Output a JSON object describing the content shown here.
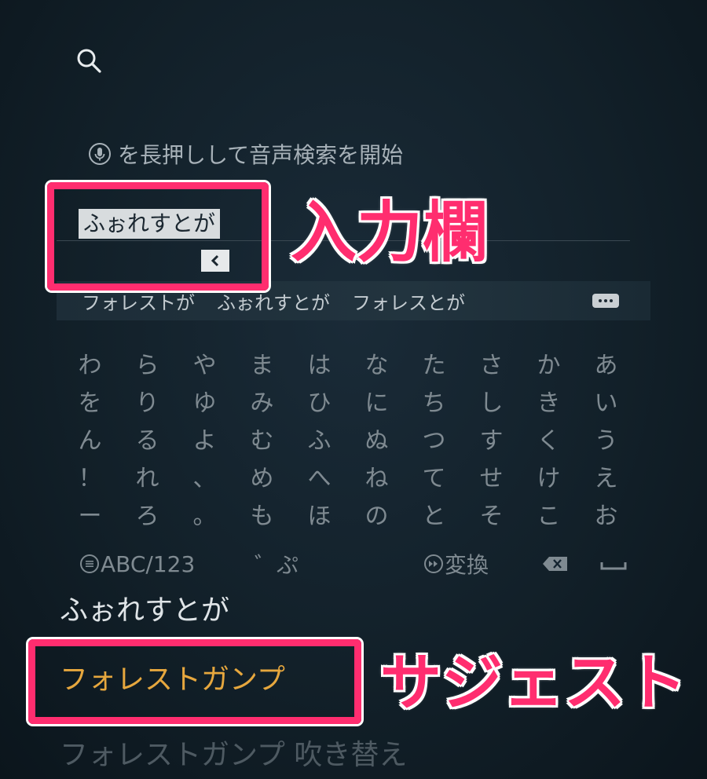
{
  "search": {
    "voice_hint": "を長押しして音声検索を開始",
    "input_value": "ふぉれすとが"
  },
  "candidates": [
    "フォレストが",
    "ふぉれすとが",
    "フォレスとが"
  ],
  "keyboard": {
    "rows": [
      [
        "わ",
        "ら",
        "や",
        "ま",
        "は",
        "な",
        "た",
        "さ",
        "か",
        "あ"
      ],
      [
        "を",
        "り",
        "ゆ",
        "み",
        "ひ",
        "に",
        "ち",
        "し",
        "き",
        "い"
      ],
      [
        "ん",
        "る",
        "よ",
        "む",
        "ふ",
        "ぬ",
        "つ",
        "す",
        "く",
        "う"
      ],
      [
        "！",
        "れ",
        "、",
        "め",
        "へ",
        "ね",
        "て",
        "せ",
        "け",
        "え"
      ],
      [
        "ー",
        "ろ",
        "。",
        "も",
        "ほ",
        "の",
        "と",
        "そ",
        "こ",
        "お"
      ]
    ],
    "abc_label": "ABC/123",
    "dakuten_label": "゛ぷ",
    "henkan_label": "変換"
  },
  "suggestions": [
    "ふぉれすとが",
    "フォレストガンプ",
    "フォレストガンプ 吹き替え"
  ],
  "annotations": {
    "input_label": "入力欄",
    "suggest_label": "サジェスト"
  },
  "colors": {
    "highlight": "#ff2d6f",
    "selected_suggestion": "#e6a73e"
  },
  "icons": [
    "search-icon",
    "microphone-icon",
    "chevron-left-icon",
    "more-icon",
    "menu-icon",
    "fast-forward-icon",
    "backspace-icon",
    "space-icon"
  ]
}
